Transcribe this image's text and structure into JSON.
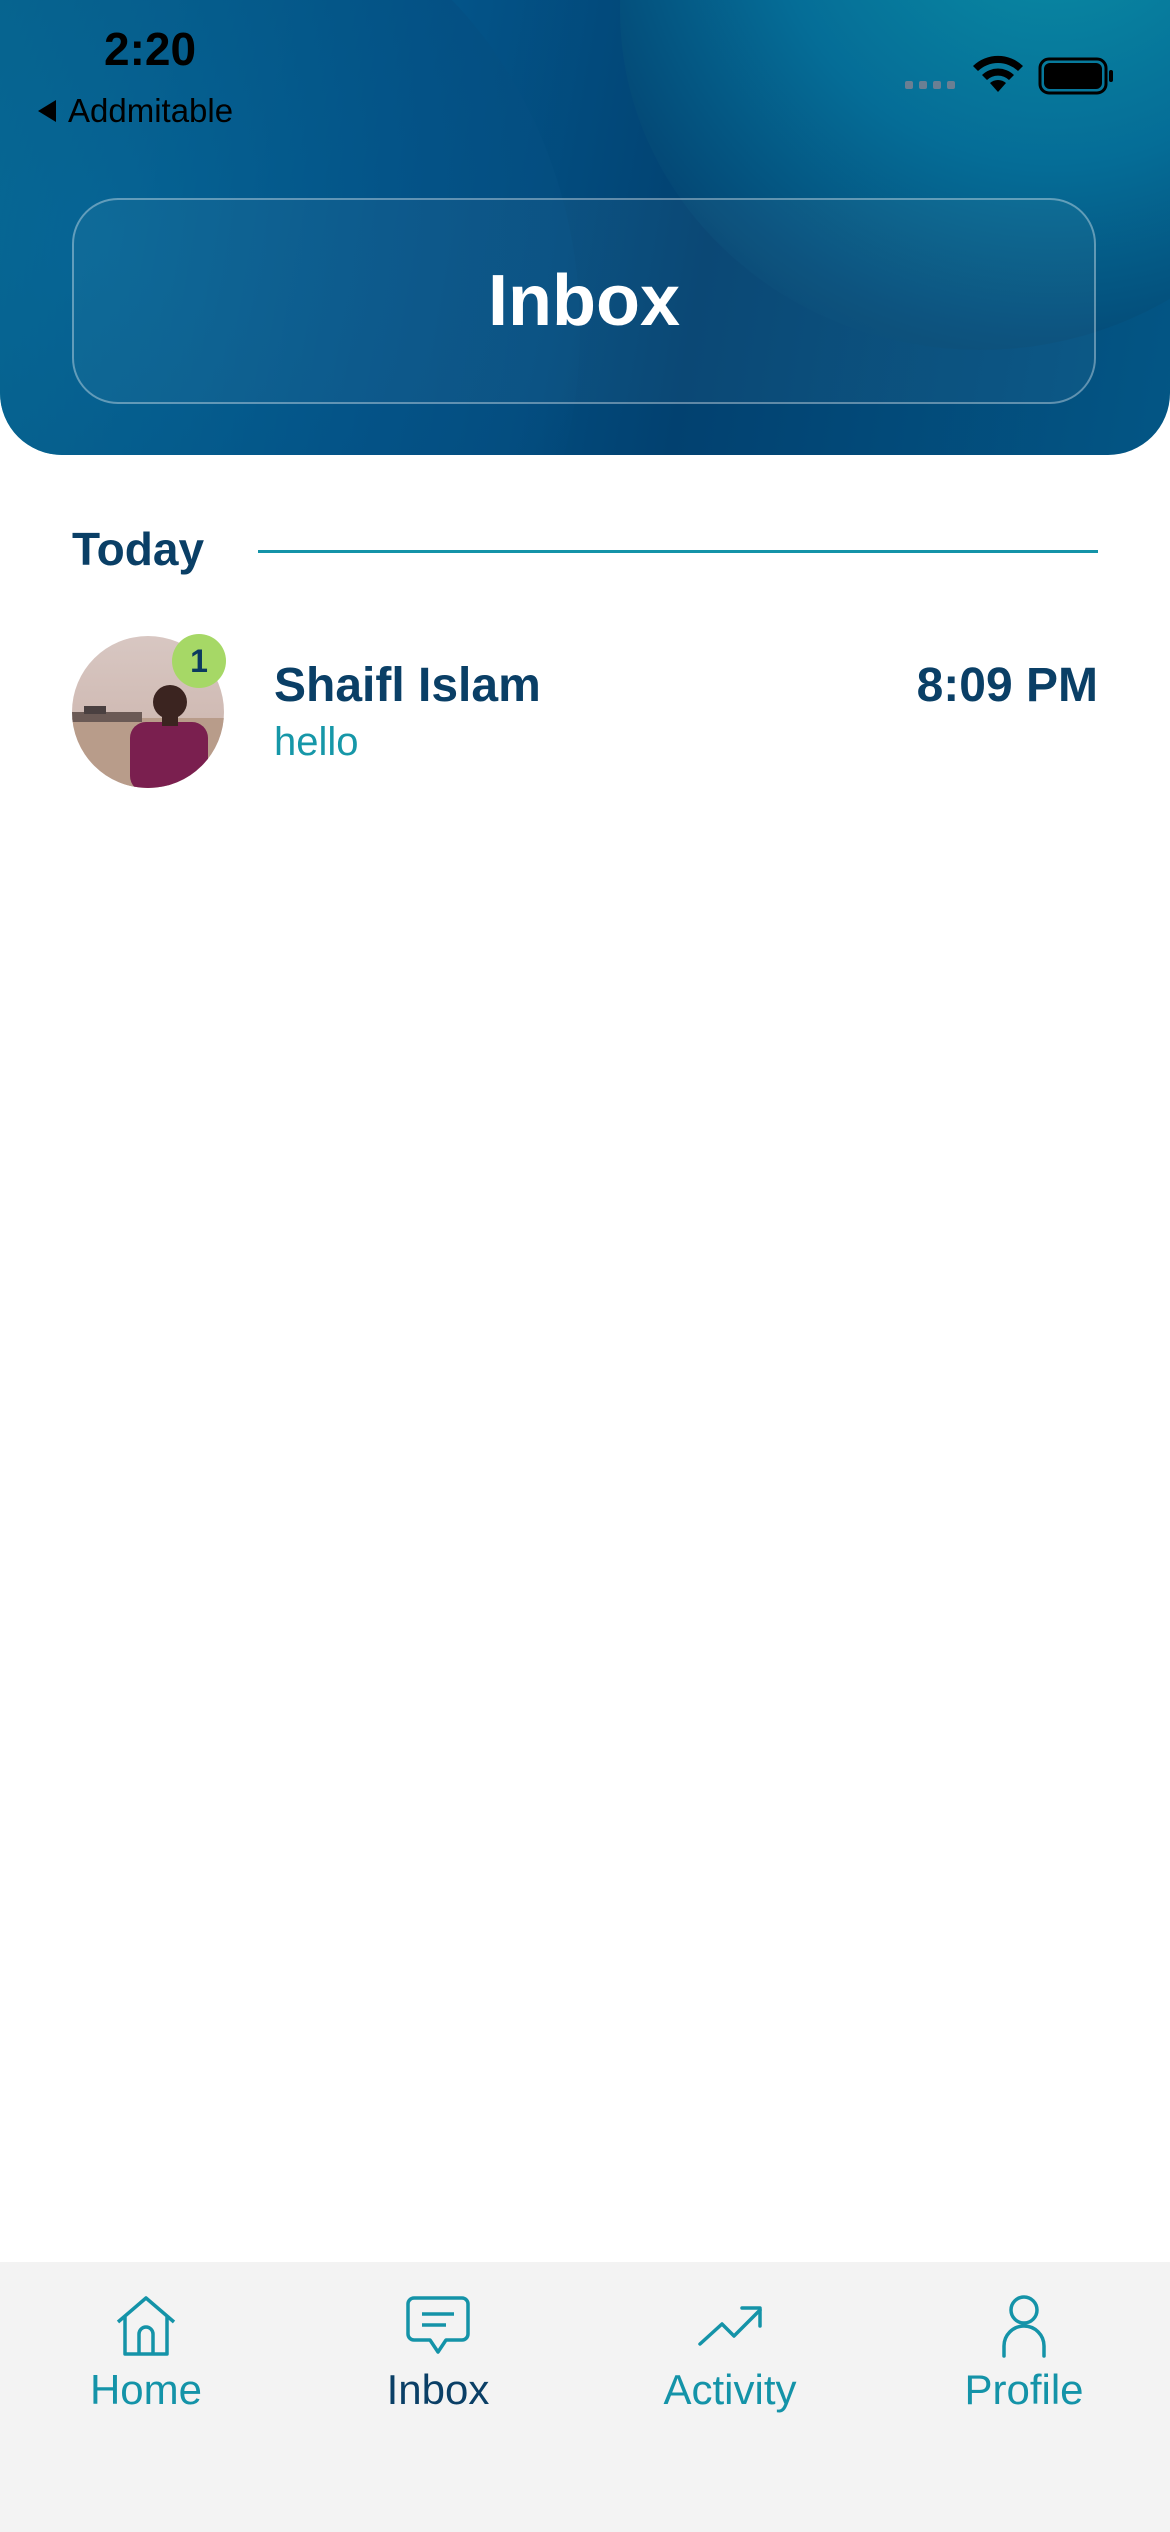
{
  "status_bar": {
    "time": "2:20",
    "back_app": "Addmitable"
  },
  "header": {
    "title": "Inbox"
  },
  "section": {
    "title": "Today"
  },
  "conversations": [
    {
      "name": "Shaifl Islam",
      "message": "hello",
      "time": "8:09 PM",
      "unread": "1"
    }
  ],
  "tabs": [
    {
      "label": "Home",
      "icon": "home-icon"
    },
    {
      "label": "Inbox",
      "icon": "chat-icon"
    },
    {
      "label": "Activity",
      "icon": "trending-up-icon"
    },
    {
      "label": "Profile",
      "icon": "user-icon"
    }
  ],
  "colors": {
    "primary": "#0a3f66",
    "accent": "#1493a8",
    "badge": "#a6d866"
  }
}
